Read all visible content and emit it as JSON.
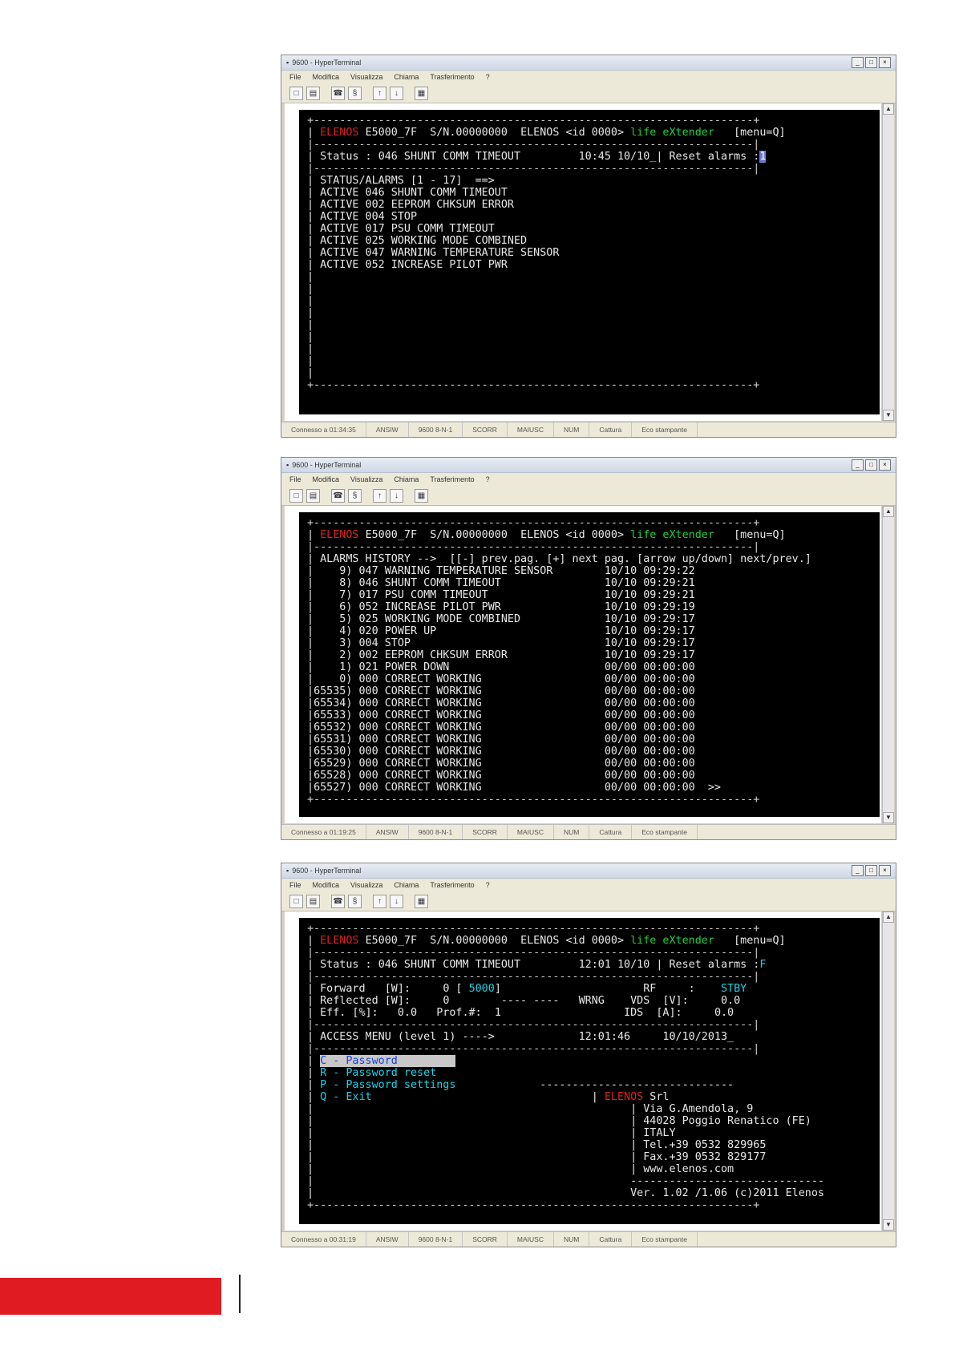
{
  "window": {
    "title": "9600 - HyperTerminal",
    "menu": [
      "File",
      "Modifica",
      "Visualizza",
      "Chiama",
      "Trasferimento",
      "?"
    ],
    "controls": [
      "_",
      "□",
      "×"
    ]
  },
  "screen1": {
    "header": {
      "brand": "ELENOS",
      "model": "E5000_7F",
      "serial": "S/N.00000000",
      "vendor": "ELENOS <id 0000>",
      "tag": "life eXtender",
      "menu": "[menu=Q]"
    },
    "status_label": "Status :",
    "status_text": "046 SHUNT COMM TIMEOUT",
    "time": "10:45 10/10_| Reset alarms :",
    "cursor": "1",
    "list_title": "STATUS/ALARMS [1 - 17]  ==>",
    "alarms": [
      "ACTIVE 046 SHUNT COMM TIMEOUT",
      "ACTIVE 002 EEPROM CHKSUM ERROR",
      "ACTIVE 004 STOP",
      "ACTIVE 017 PSU COMM TIMEOUT",
      "ACTIVE 025 WORKING MODE COMBINED",
      "ACTIVE 047 WARNING TEMPERATURE SENSOR",
      "ACTIVE 052 INCREASE PILOT PWR"
    ],
    "statusbar": [
      "Connesso a 01:34:35",
      "ANSIW",
      "9600 8-N-1",
      "SCORR",
      "MAIUSC",
      "NUM",
      "Cattura",
      "Eco stampante"
    ]
  },
  "screen2": {
    "header": {
      "brand": "ELENOS",
      "model": "E5000_7F",
      "serial": "S/N.00000000",
      "vendor": "ELENOS <id 0000>",
      "tag": "life eXtender",
      "menu": "[menu=Q]"
    },
    "history_title": "ALARMS HISTORY -->  [[-] prev.pag. [+] next pag. [arrow up/down] next/prev.]",
    "history": [
      {
        "idx": "    9)",
        "code": "047",
        "text": "WARNING TEMPERATURE SENSOR",
        "date": "10/10",
        "time": "09:29:22"
      },
      {
        "idx": "    8)",
        "code": "046",
        "text": "SHUNT COMM TIMEOUT",
        "date": "10/10",
        "time": "09:29:21"
      },
      {
        "idx": "    7)",
        "code": "017",
        "text": "PSU COMM TIMEOUT",
        "date": "10/10",
        "time": "09:29:21"
      },
      {
        "idx": "    6)",
        "code": "052",
        "text": "INCREASE PILOT PWR",
        "date": "10/10",
        "time": "09:29:19"
      },
      {
        "idx": "    5)",
        "code": "025",
        "text": "WORKING MODE COMBINED",
        "date": "10/10",
        "time": "09:29:17"
      },
      {
        "idx": "    4)",
        "code": "020",
        "text": "POWER UP",
        "date": "10/10",
        "time": "09:29:17"
      },
      {
        "idx": "    3)",
        "code": "004",
        "text": "STOP",
        "date": "10/10",
        "time": "09:29:17"
      },
      {
        "idx": "    2)",
        "code": "002",
        "text": "EEPROM CHKSUM ERROR",
        "date": "10/10",
        "time": "09:29:17"
      },
      {
        "idx": "    1)",
        "code": "021",
        "text": "POWER DOWN",
        "date": "00/00",
        "time": "00:00:00"
      },
      {
        "idx": "    0)",
        "code": "000",
        "text": "CORRECT WORKING",
        "date": "00/00",
        "time": "00:00:00"
      },
      {
        "idx": "65535)",
        "code": "000",
        "text": "CORRECT WORKING",
        "date": "00/00",
        "time": "00:00:00"
      },
      {
        "idx": "65534)",
        "code": "000",
        "text": "CORRECT WORKING",
        "date": "00/00",
        "time": "00:00:00"
      },
      {
        "idx": "65533)",
        "code": "000",
        "text": "CORRECT WORKING",
        "date": "00/00",
        "time": "00:00:00"
      },
      {
        "idx": "65532)",
        "code": "000",
        "text": "CORRECT WORKING",
        "date": "00/00",
        "time": "00:00:00"
      },
      {
        "idx": "65531)",
        "code": "000",
        "text": "CORRECT WORKING",
        "date": "00/00",
        "time": "00:00:00"
      },
      {
        "idx": "65530)",
        "code": "000",
        "text": "CORRECT WORKING",
        "date": "00/00",
        "time": "00:00:00"
      },
      {
        "idx": "65529)",
        "code": "000",
        "text": "CORRECT WORKING",
        "date": "00/00",
        "time": "00:00:00"
      },
      {
        "idx": "65528)",
        "code": "000",
        "text": "CORRECT WORKING",
        "date": "00/00",
        "time": "00:00:00"
      },
      {
        "idx": "65527)",
        "code": "000",
        "text": "CORRECT WORKING",
        "date": "00/00",
        "time": "00:00:00"
      }
    ],
    "more": ">>",
    "statusbar": [
      "Connesso a 01:19:25",
      "ANSIW",
      "9600 8-N-1",
      "SCORR",
      "MAIUSC",
      "NUM",
      "Cattura",
      "Eco stampante"
    ]
  },
  "screen3": {
    "header": {
      "brand": "ELENOS",
      "model": "E5000_7F",
      "serial": "S/N.00000000",
      "vendor": "ELENOS <id 0000>",
      "tag": "life eXtender",
      "menu": "[menu=Q]"
    },
    "status_label": "Status :",
    "status_text": "046 SHUNT COMM TIMEOUT",
    "time": "12:01 10/10 | Reset alarms :",
    "reset_value": "F",
    "measures": {
      "forward_label": "Forward   [W]:",
      "forward_value": "0",
      "forward_set": "5000",
      "reflected_label": "Reflected [W]:",
      "reflected_value": "0",
      "eff_label": "Eff. [%]:",
      "eff_value": "0.0",
      "prof_label": "Prof.#:",
      "prof_value": "1",
      "wrng": "WRNG",
      "rf_label": "RF     :",
      "rf_value": "STBY",
      "vds_label": "VDS  [V]:",
      "vds_value": "0.0",
      "ids_label": "IDS  [A]:",
      "ids_value": "0.0"
    },
    "access_title": "ACCESS MENU (level 1) ---->",
    "access_time": "12:01:46",
    "access_date": "10/10/2013_",
    "menu_items": [
      "C - Password",
      "R - Password reset",
      "P - Password settings",
      "Q - Exit"
    ],
    "company": {
      "name": "ELENOS",
      "suffix": "Srl",
      "address": "Via G.Amendola, 9",
      "city": "44028 Poggio Renatico (FE)",
      "country": "ITALY",
      "tel": "Tel.+39 0532 829965",
      "fax": "Fax.+39 0532 829177",
      "web": "www.elenos.com"
    },
    "version": "Ver. 1.02 /1.06 (c)2011 Elenos",
    "statusbar": [
      "Connesso a 00:31:19",
      "ANSIW",
      "9600 8-N-1",
      "SCORR",
      "MAIUSC",
      "NUM",
      "Cattura",
      "Eco stampante"
    ]
  },
  "colors": {
    "brand_red": "#e01b22",
    "terminal_bg": "#000000",
    "terminal_green": "#20d040",
    "terminal_cyan": "#19d2e8"
  }
}
